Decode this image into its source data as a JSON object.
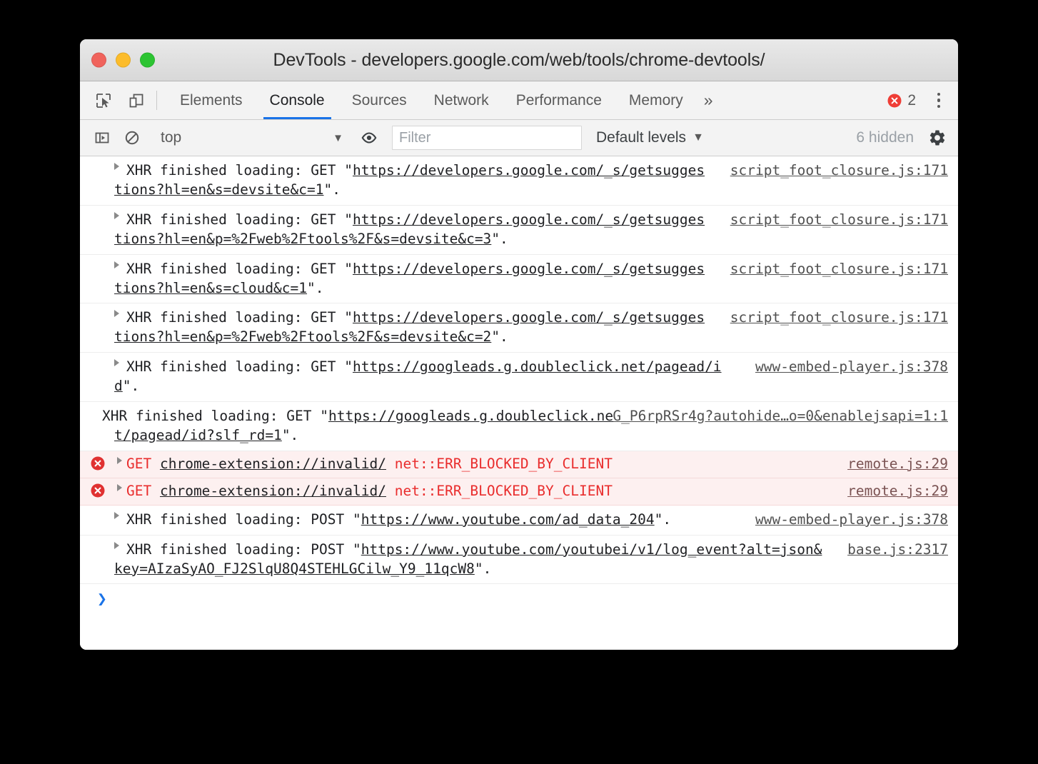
{
  "window": {
    "title": "DevTools - developers.google.com/web/tools/chrome-devtools/",
    "traffic_lights": [
      "close-red",
      "minimize-yellow",
      "maximize-green"
    ]
  },
  "tabbar": {
    "icons": [
      {
        "name": "inspect-element-icon",
        "label": "Inspect element"
      },
      {
        "name": "device-toolbar-icon",
        "label": "Toggle device toolbar"
      }
    ],
    "tabs": [
      {
        "label": "Elements",
        "active": false
      },
      {
        "label": "Console",
        "active": true
      },
      {
        "label": "Sources",
        "active": false
      },
      {
        "label": "Network",
        "active": false
      },
      {
        "label": "Performance",
        "active": false
      },
      {
        "label": "Memory",
        "active": false
      }
    ],
    "overflow_label": "»",
    "error_count": "2",
    "error_icon": "error-circle-icon",
    "menu_icon": "kebab-menu-icon"
  },
  "filterbar": {
    "sidebar_toggle_icon": "console-sidebar-icon",
    "clear_icon": "clear-console-icon",
    "context": "top",
    "context_caret": "▼",
    "eye_icon": "live-expression-icon",
    "filter_placeholder": "Filter",
    "filter_value": "",
    "levels_label": "Default levels",
    "levels_caret": "▼",
    "hidden_label": "6 hidden",
    "settings_icon": "gear-icon"
  },
  "console": {
    "messages": [
      {
        "type": "log",
        "arrow": true,
        "prefix": "XHR finished loading: GET \"",
        "link": "https://developers.google.com/_s/getsuggestions?hl=en&s=devsite&c=1",
        "suffix": "\".",
        "source": "script_foot_closure.js:171"
      },
      {
        "type": "log",
        "arrow": true,
        "prefix": "XHR finished loading: GET \"",
        "link": "https://developers.google.com/_s/getsuggestions?hl=en&p=%2Fweb%2Ftools%2F&s=devsite&c=3",
        "suffix": "\".",
        "source": "script_foot_closure.js:171"
      },
      {
        "type": "log",
        "arrow": true,
        "prefix": "XHR finished loading: GET \"",
        "link": "https://developers.google.com/_s/getsuggestions?hl=en&s=cloud&c=1",
        "suffix": "\".",
        "source": "script_foot_closure.js:171"
      },
      {
        "type": "log",
        "arrow": true,
        "prefix": "XHR finished loading: GET \"",
        "link": "https://developers.google.com/_s/getsuggestions?hl=en&p=%2Fweb%2Ftools%2F&s=devsite&c=2",
        "suffix": "\".",
        "source": "script_foot_closure.js:171"
      },
      {
        "type": "log",
        "arrow": true,
        "prefix": "XHR finished loading: GET \"",
        "link": "https://googleads.g.doubleclick.net/pagead/id",
        "suffix": "\".",
        "source": "www-embed-player.js:378"
      },
      {
        "type": "log",
        "arrow": false,
        "prefix": "XHR finished loading: GET \"",
        "link": "https://googleads.g.doubleclick.net/pagead/id?slf_rd=1",
        "suffix": "\".",
        "source": "G_P6rpRSr4g?autohide…o=0&enablejsapi=1:1"
      },
      {
        "type": "error",
        "arrow": true,
        "method": "GET",
        "link": "chrome-extension://invalid/",
        "error_text": "net::ERR_BLOCKED_BY_CLIENT",
        "source": "remote.js:29"
      },
      {
        "type": "error",
        "arrow": true,
        "method": "GET",
        "link": "chrome-extension://invalid/",
        "error_text": "net::ERR_BLOCKED_BY_CLIENT",
        "source": "remote.js:29"
      },
      {
        "type": "log",
        "arrow": true,
        "prefix": "XHR finished loading: POST \"",
        "link": "https://www.youtube.com/ad_data_204",
        "suffix": "\".",
        "source": "www-embed-player.js:378"
      },
      {
        "type": "log",
        "arrow": true,
        "prefix": "XHR finished loading: POST \"",
        "link": "https://www.youtube.com/youtubei/v1/log_event?alt=json&key=AIzaSyAO_FJ2SlqU8Q4STEHLGCilw_Y9_11qcW8",
        "suffix": "\".",
        "source": "base.js:2317"
      }
    ],
    "prompt_symbol": "❯",
    "prompt_value": ""
  },
  "colors": {
    "accent": "#1a73e8",
    "error_red": "#e92d2d",
    "error_bg": "#fdf0f0",
    "toolbar_bg": "#f3f3f3"
  }
}
